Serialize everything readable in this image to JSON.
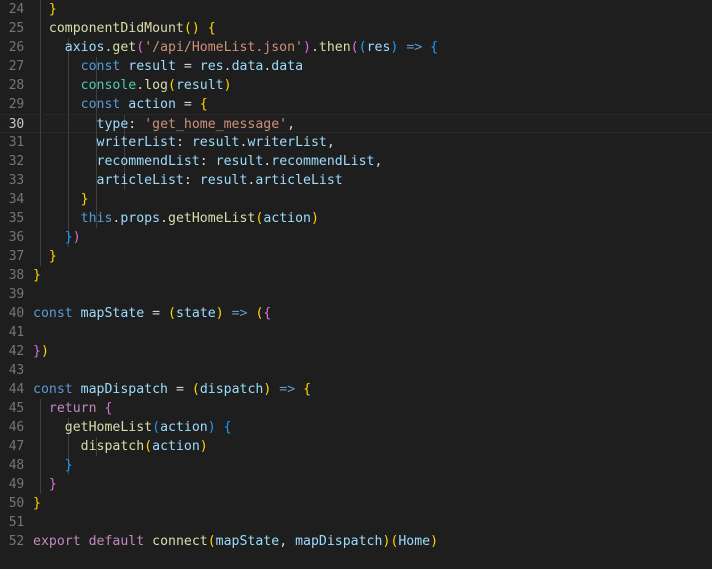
{
  "editor": {
    "language": "javascript",
    "theme": "dark-plus",
    "background_color": "#1e1e1e",
    "active_line": 30,
    "first_visible_line": 24,
    "last_visible_line": 52,
    "gutter_color": "#6e7681",
    "active_gutter_color": "#c6c6c6",
    "indent_guide_color": "#404040",
    "accent_colors": {
      "keyword": "#569cd6",
      "keyword_control": "#c586c0",
      "function": "#dcdcaa",
      "variable": "#9cdcfe",
      "string": "#ce9178",
      "class": "#4ec9b0",
      "punctuation": "#d4d4d4",
      "bracket_level_0": "#ffd700",
      "bracket_level_1": "#da70d6",
      "bracket_level_2": "#179fff"
    }
  },
  "lines": [
    {
      "n": "24",
      "guides": [
        40
      ],
      "tokens": [
        {
          "t": "  ",
          "c": "op"
        },
        {
          "t": "}",
          "c": "b0"
        }
      ]
    },
    {
      "n": "25",
      "guides": [
        40
      ],
      "tokens": [
        {
          "t": "  ",
          "c": "op"
        },
        {
          "t": "componentDidMount",
          "c": "fn"
        },
        {
          "t": "(",
          "c": "b0"
        },
        {
          "t": ")",
          "c": "b0"
        },
        {
          "t": " ",
          "c": "op"
        },
        {
          "t": "{",
          "c": "b0"
        }
      ]
    },
    {
      "n": "26",
      "guides": [
        40,
        68
      ],
      "tokens": [
        {
          "t": "    ",
          "c": "op"
        },
        {
          "t": "axios",
          "c": "var"
        },
        {
          "t": ".",
          "c": "op"
        },
        {
          "t": "get",
          "c": "fn"
        },
        {
          "t": "(",
          "c": "b1"
        },
        {
          "t": "'/api/HomeList.json'",
          "c": "str"
        },
        {
          "t": ")",
          "c": "b1"
        },
        {
          "t": ".",
          "c": "op"
        },
        {
          "t": "then",
          "c": "fn"
        },
        {
          "t": "(",
          "c": "b1"
        },
        {
          "t": "(",
          "c": "b2"
        },
        {
          "t": "res",
          "c": "var"
        },
        {
          "t": ")",
          "c": "b2"
        },
        {
          "t": " ",
          "c": "op"
        },
        {
          "t": "=>",
          "c": "kw"
        },
        {
          "t": " ",
          "c": "op"
        },
        {
          "t": "{",
          "c": "b2"
        }
      ]
    },
    {
      "n": "27",
      "guides": [
        40,
        68,
        96
      ],
      "tokens": [
        {
          "t": "      ",
          "c": "op"
        },
        {
          "t": "const",
          "c": "kw"
        },
        {
          "t": " ",
          "c": "op"
        },
        {
          "t": "result",
          "c": "var"
        },
        {
          "t": " ",
          "c": "op"
        },
        {
          "t": "=",
          "c": "op"
        },
        {
          "t": " ",
          "c": "op"
        },
        {
          "t": "res",
          "c": "var"
        },
        {
          "t": ".",
          "c": "op"
        },
        {
          "t": "data",
          "c": "var"
        },
        {
          "t": ".",
          "c": "op"
        },
        {
          "t": "data",
          "c": "var"
        }
      ]
    },
    {
      "n": "28",
      "guides": [
        40,
        68,
        96
      ],
      "tokens": [
        {
          "t": "      ",
          "c": "op"
        },
        {
          "t": "console",
          "c": "cls"
        },
        {
          "t": ".",
          "c": "op"
        },
        {
          "t": "log",
          "c": "fn"
        },
        {
          "t": "(",
          "c": "b0"
        },
        {
          "t": "result",
          "c": "var"
        },
        {
          "t": ")",
          "c": "b0"
        }
      ]
    },
    {
      "n": "29",
      "guides": [
        40,
        68,
        96
      ],
      "tokens": [
        {
          "t": "      ",
          "c": "op"
        },
        {
          "t": "const",
          "c": "kw"
        },
        {
          "t": " ",
          "c": "op"
        },
        {
          "t": "action",
          "c": "var"
        },
        {
          "t": " ",
          "c": "op"
        },
        {
          "t": "=",
          "c": "op"
        },
        {
          "t": " ",
          "c": "op"
        },
        {
          "t": "{",
          "c": "b0"
        }
      ]
    },
    {
      "n": "30",
      "active": true,
      "guides": [
        40,
        68,
        96,
        124
      ],
      "tokens": [
        {
          "t": "        ",
          "c": "op"
        },
        {
          "t": "type",
          "c": "var"
        },
        {
          "t": ":",
          "c": "op"
        },
        {
          "t": " ",
          "c": "op"
        },
        {
          "t": "'get_home_message'",
          "c": "str"
        },
        {
          "t": ",",
          "c": "op"
        }
      ]
    },
    {
      "n": "31",
      "guides": [
        40,
        68,
        96,
        124
      ],
      "tokens": [
        {
          "t": "        ",
          "c": "op"
        },
        {
          "t": "writerList",
          "c": "var"
        },
        {
          "t": ":",
          "c": "op"
        },
        {
          "t": " ",
          "c": "op"
        },
        {
          "t": "result",
          "c": "var"
        },
        {
          "t": ".",
          "c": "op"
        },
        {
          "t": "writerList",
          "c": "var"
        },
        {
          "t": ",",
          "c": "op"
        }
      ]
    },
    {
      "n": "32",
      "guides": [
        40,
        68,
        96,
        124
      ],
      "tokens": [
        {
          "t": "        ",
          "c": "op"
        },
        {
          "t": "recommendList",
          "c": "var"
        },
        {
          "t": ":",
          "c": "op"
        },
        {
          "t": " ",
          "c": "op"
        },
        {
          "t": "result",
          "c": "var"
        },
        {
          "t": ".",
          "c": "op"
        },
        {
          "t": "recommendList",
          "c": "var"
        },
        {
          "t": ",",
          "c": "op"
        }
      ]
    },
    {
      "n": "33",
      "guides": [
        40,
        68,
        96,
        124
      ],
      "tokens": [
        {
          "t": "        ",
          "c": "op"
        },
        {
          "t": "articleList",
          "c": "var"
        },
        {
          "t": ":",
          "c": "op"
        },
        {
          "t": " ",
          "c": "op"
        },
        {
          "t": "result",
          "c": "var"
        },
        {
          "t": ".",
          "c": "op"
        },
        {
          "t": "articleList",
          "c": "var"
        }
      ]
    },
    {
      "n": "34",
      "guides": [
        40,
        68,
        96
      ],
      "tokens": [
        {
          "t": "      ",
          "c": "op"
        },
        {
          "t": "}",
          "c": "b0"
        }
      ]
    },
    {
      "n": "35",
      "guides": [
        40,
        68,
        96
      ],
      "tokens": [
        {
          "t": "      ",
          "c": "op"
        },
        {
          "t": "this",
          "c": "kw"
        },
        {
          "t": ".",
          "c": "op"
        },
        {
          "t": "props",
          "c": "var"
        },
        {
          "t": ".",
          "c": "op"
        },
        {
          "t": "getHomeList",
          "c": "fn"
        },
        {
          "t": "(",
          "c": "b0"
        },
        {
          "t": "action",
          "c": "var"
        },
        {
          "t": ")",
          "c": "b0"
        }
      ]
    },
    {
      "n": "36",
      "guides": [
        40,
        68
      ],
      "tokens": [
        {
          "t": "    ",
          "c": "op"
        },
        {
          "t": "}",
          "c": "b2"
        },
        {
          "t": ")",
          "c": "b1"
        }
      ]
    },
    {
      "n": "37",
      "guides": [
        40
      ],
      "tokens": [
        {
          "t": "  ",
          "c": "op"
        },
        {
          "t": "}",
          "c": "b0"
        }
      ]
    },
    {
      "n": "38",
      "guides": [],
      "tokens": [
        {
          "t": "}",
          "c": "b0"
        }
      ]
    },
    {
      "n": "39",
      "guides": [],
      "tokens": []
    },
    {
      "n": "40",
      "guides": [],
      "tokens": [
        {
          "t": "const",
          "c": "kw"
        },
        {
          "t": " ",
          "c": "op"
        },
        {
          "t": "mapState",
          "c": "var"
        },
        {
          "t": " ",
          "c": "op"
        },
        {
          "t": "=",
          "c": "op"
        },
        {
          "t": " ",
          "c": "op"
        },
        {
          "t": "(",
          "c": "b0"
        },
        {
          "t": "state",
          "c": "var"
        },
        {
          "t": ")",
          "c": "b0"
        },
        {
          "t": " ",
          "c": "op"
        },
        {
          "t": "=>",
          "c": "kw"
        },
        {
          "t": " ",
          "c": "op"
        },
        {
          "t": "(",
          "c": "b0"
        },
        {
          "t": "{",
          "c": "b1"
        }
      ]
    },
    {
      "n": "41",
      "guides": [],
      "tokens": []
    },
    {
      "n": "42",
      "guides": [],
      "tokens": [
        {
          "t": "}",
          "c": "b1"
        },
        {
          "t": ")",
          "c": "b0"
        }
      ]
    },
    {
      "n": "43",
      "guides": [],
      "tokens": []
    },
    {
      "n": "44",
      "guides": [],
      "tokens": [
        {
          "t": "const",
          "c": "kw"
        },
        {
          "t": " ",
          "c": "op"
        },
        {
          "t": "mapDispatch",
          "c": "var"
        },
        {
          "t": " ",
          "c": "op"
        },
        {
          "t": "=",
          "c": "op"
        },
        {
          "t": " ",
          "c": "op"
        },
        {
          "t": "(",
          "c": "b0"
        },
        {
          "t": "dispatch",
          "c": "var"
        },
        {
          "t": ")",
          "c": "b0"
        },
        {
          "t": " ",
          "c": "op"
        },
        {
          "t": "=>",
          "c": "kw"
        },
        {
          "t": " ",
          "c": "op"
        },
        {
          "t": "{",
          "c": "b0"
        }
      ]
    },
    {
      "n": "45",
      "guides": [
        40
      ],
      "tokens": [
        {
          "t": "  ",
          "c": "op"
        },
        {
          "t": "return",
          "c": "kwp"
        },
        {
          "t": " ",
          "c": "op"
        },
        {
          "t": "{",
          "c": "b1"
        }
      ]
    },
    {
      "n": "46",
      "guides": [
        40,
        68
      ],
      "tokens": [
        {
          "t": "    ",
          "c": "op"
        },
        {
          "t": "getHomeList",
          "c": "fn"
        },
        {
          "t": "(",
          "c": "b2"
        },
        {
          "t": "action",
          "c": "var"
        },
        {
          "t": ")",
          "c": "b2"
        },
        {
          "t": " ",
          "c": "op"
        },
        {
          "t": "{",
          "c": "b2"
        }
      ]
    },
    {
      "n": "47",
      "guides": [
        40,
        68,
        96
      ],
      "tokens": [
        {
          "t": "      ",
          "c": "op"
        },
        {
          "t": "dispatch",
          "c": "fn"
        },
        {
          "t": "(",
          "c": "b0"
        },
        {
          "t": "action",
          "c": "var"
        },
        {
          "t": ")",
          "c": "b0"
        }
      ]
    },
    {
      "n": "48",
      "guides": [
        40,
        68
      ],
      "tokens": [
        {
          "t": "    ",
          "c": "op"
        },
        {
          "t": "}",
          "c": "b2"
        }
      ]
    },
    {
      "n": "49",
      "guides": [
        40
      ],
      "tokens": [
        {
          "t": "  ",
          "c": "op"
        },
        {
          "t": "}",
          "c": "b1"
        }
      ]
    },
    {
      "n": "50",
      "guides": [],
      "tokens": [
        {
          "t": "}",
          "c": "b0"
        }
      ]
    },
    {
      "n": "51",
      "guides": [],
      "tokens": []
    },
    {
      "n": "52",
      "guides": [],
      "tokens": [
        {
          "t": "export",
          "c": "kwp"
        },
        {
          "t": " ",
          "c": "op"
        },
        {
          "t": "default",
          "c": "kwp"
        },
        {
          "t": " ",
          "c": "op"
        },
        {
          "t": "connect",
          "c": "fn"
        },
        {
          "t": "(",
          "c": "b0"
        },
        {
          "t": "mapState",
          "c": "var"
        },
        {
          "t": ",",
          "c": "op"
        },
        {
          "t": " ",
          "c": "op"
        },
        {
          "t": "mapDispatch",
          "c": "var"
        },
        {
          "t": ")",
          "c": "b0"
        },
        {
          "t": "(",
          "c": "b0"
        },
        {
          "t": "Home",
          "c": "var"
        },
        {
          "t": ")",
          "c": "b0"
        }
      ]
    }
  ]
}
